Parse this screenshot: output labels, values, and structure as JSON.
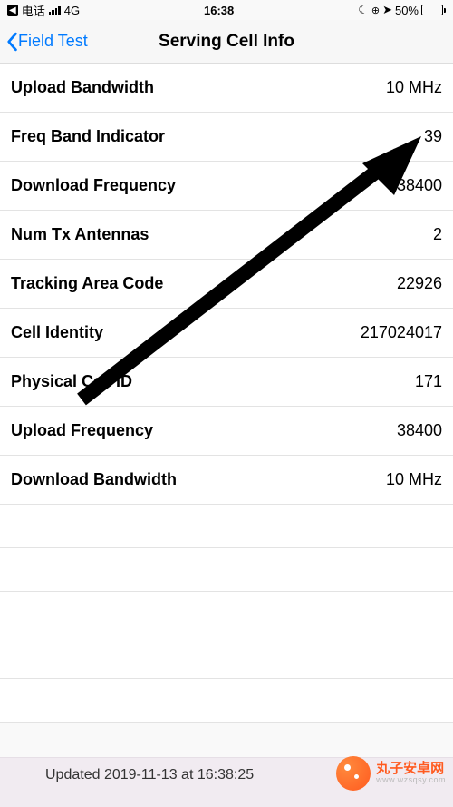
{
  "status": {
    "carrier": "电话",
    "network": "4G",
    "time": "16:38",
    "battery_pct": "50%"
  },
  "nav": {
    "back_label": "Field Test",
    "title": "Serving Cell Info"
  },
  "rows": [
    {
      "label": "Upload Bandwidth",
      "value": "10 MHz"
    },
    {
      "label": "Freq Band Indicator",
      "value": "39"
    },
    {
      "label": "Download Frequency",
      "value": "38400"
    },
    {
      "label": "Num Tx Antennas",
      "value": "2"
    },
    {
      "label": "Tracking Area Code",
      "value": "22926"
    },
    {
      "label": "Cell Identity",
      "value": "217024017"
    },
    {
      "label": "Physical Cell ID",
      "value": "171"
    },
    {
      "label": "Upload Frequency",
      "value": "38400"
    },
    {
      "label": "Download Bandwidth",
      "value": "10 MHz"
    }
  ],
  "footer": {
    "text": "Updated 2019-11-13 at 16:38:25"
  },
  "watermark": {
    "line1": "丸子安卓网",
    "line2": "www.wzsqsy.com"
  }
}
